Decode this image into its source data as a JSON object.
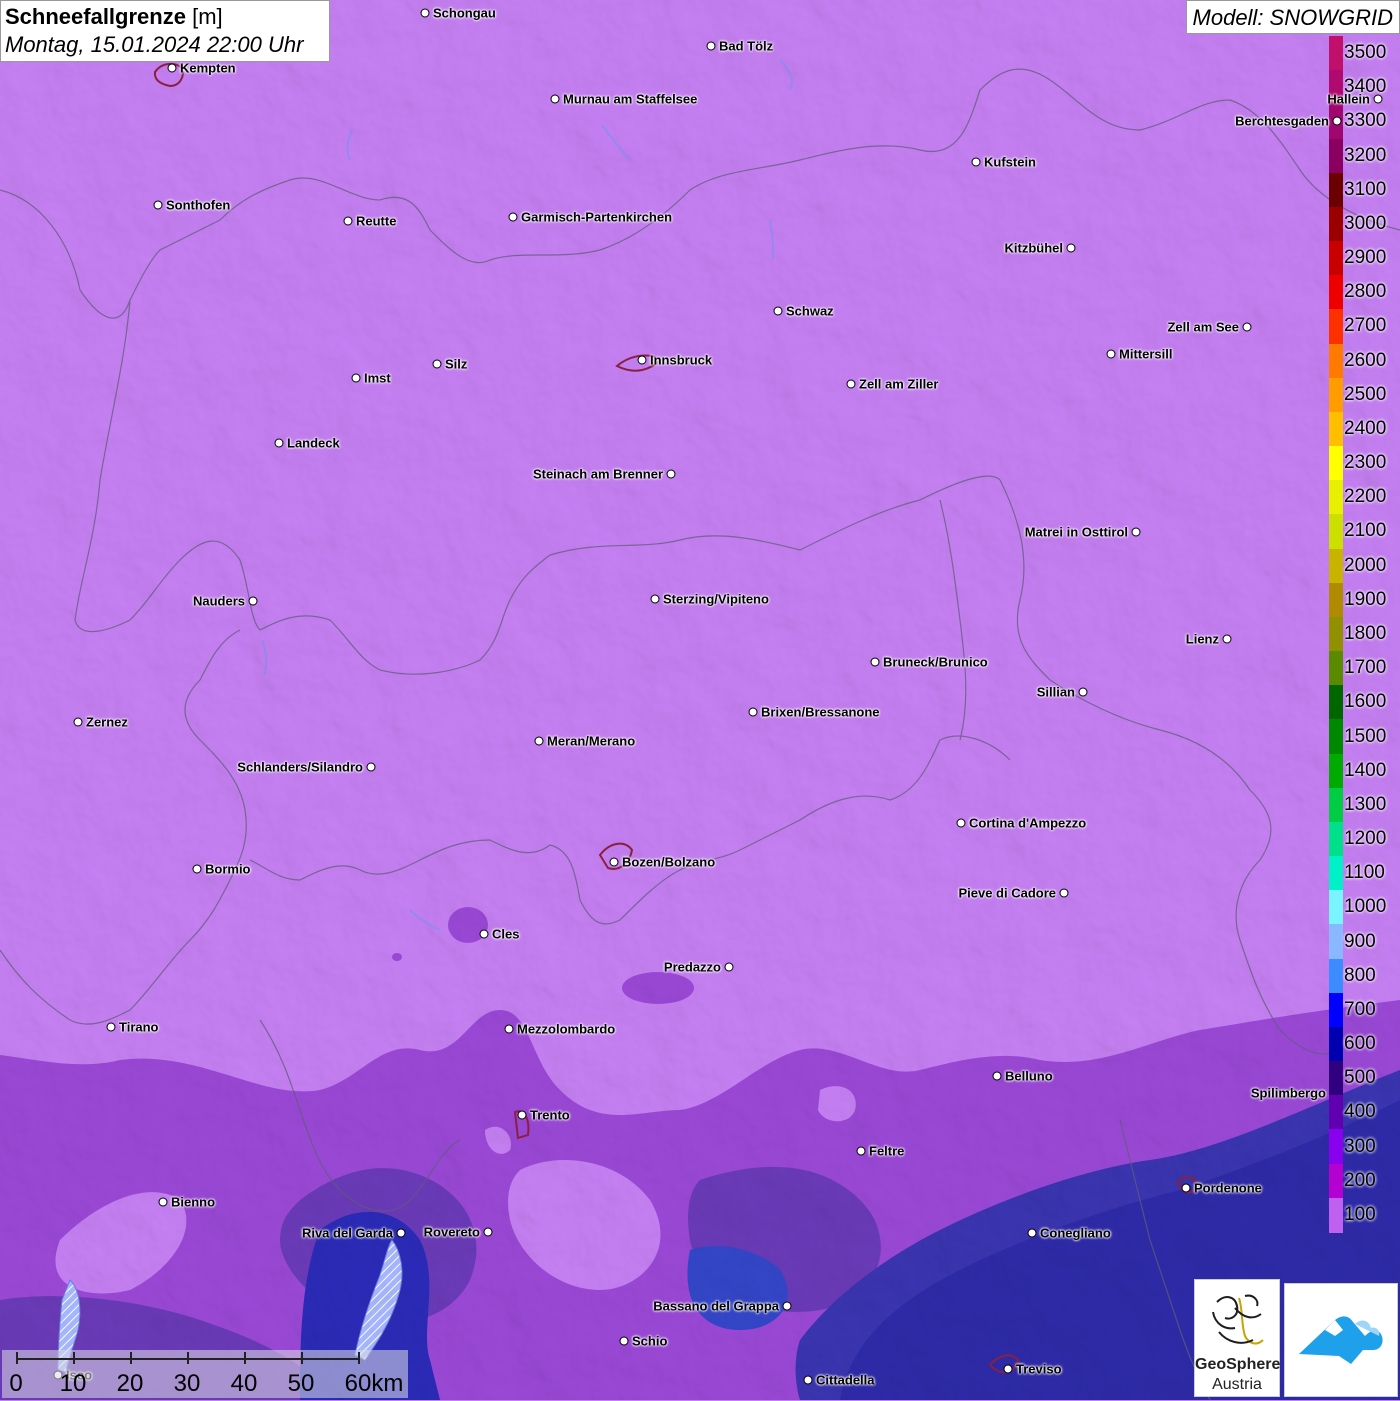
{
  "header": {
    "title": "Schneefallgrenze",
    "unit": "[m]",
    "datetime": "Montag, 15.01.2024 22:00 Uhr",
    "model": "Modell: SNOWGRID"
  },
  "colors": {
    "background_zone": "#c57ff2",
    "low_zone": "#3b2aa6",
    "mid_zone": "#8a3fc8"
  },
  "legend": {
    "items": [
      {
        "label": "3500",
        "color": "#c0106c"
      },
      {
        "label": "3400",
        "color": "#b00a70"
      },
      {
        "label": "3300",
        "color": "#a00670"
      },
      {
        "label": "3200",
        "color": "#8a0060"
      },
      {
        "label": "3100",
        "color": "#6a0000"
      },
      {
        "label": "3000",
        "color": "#9a0000"
      },
      {
        "label": "2900",
        "color": "#c80000"
      },
      {
        "label": "2800",
        "color": "#ee0000"
      },
      {
        "label": "2700",
        "color": "#ff3000"
      },
      {
        "label": "2600",
        "color": "#ff7a00"
      },
      {
        "label": "2500",
        "color": "#ff9c00"
      },
      {
        "label": "2400",
        "color": "#ffbe00"
      },
      {
        "label": "2300",
        "color": "#ffff00"
      },
      {
        "label": "2200",
        "color": "#e6f000"
      },
      {
        "label": "2100",
        "color": "#cce000"
      },
      {
        "label": "2000",
        "color": "#c8b400"
      },
      {
        "label": "1900",
        "color": "#b08a00"
      },
      {
        "label": "1800",
        "color": "#909000"
      },
      {
        "label": "1700",
        "color": "#5a8a00"
      },
      {
        "label": "1600",
        "color": "#006600"
      },
      {
        "label": "1500",
        "color": "#008800"
      },
      {
        "label": "1400",
        "color": "#00aa00"
      },
      {
        "label": "1300",
        "color": "#00cc44"
      },
      {
        "label": "1200",
        "color": "#00e08a"
      },
      {
        "label": "1100",
        "color": "#00f0c8"
      },
      {
        "label": "1000",
        "color": "#7af5ff"
      },
      {
        "label": "900",
        "color": "#8ab8ff"
      },
      {
        "label": "800",
        "color": "#3c8cff"
      },
      {
        "label": "700",
        "color": "#0000ff"
      },
      {
        "label": "600",
        "color": "#0000b0"
      },
      {
        "label": "500",
        "color": "#300080"
      },
      {
        "label": "400",
        "color": "#6000b0"
      },
      {
        "label": "300",
        "color": "#8800ee"
      },
      {
        "label": "200",
        "color": "#b400d0"
      },
      {
        "label": "100",
        "color": "#c060f0"
      }
    ]
  },
  "cities": [
    {
      "name": "Schongau",
      "side": "r"
    },
    {
      "name": "Bad Tölz",
      "side": "r"
    },
    {
      "name": "Kempten",
      "side": "r"
    },
    {
      "name": "Murnau am Staffelsee",
      "side": "r"
    },
    {
      "name": "Hallein",
      "side": "l"
    },
    {
      "name": "Berchtesgaden",
      "side": "l"
    },
    {
      "name": "Kufstein",
      "side": "r"
    },
    {
      "name": "Sonthofen",
      "side": "r"
    },
    {
      "name": "Reutte",
      "side": "r"
    },
    {
      "name": "Garmisch-Partenkirchen",
      "side": "r"
    },
    {
      "name": "Kitzbühel",
      "side": "l"
    },
    {
      "name": "Schwaz",
      "side": "r"
    },
    {
      "name": "Zell am See",
      "side": "l"
    },
    {
      "name": "Mittersill",
      "side": "r"
    },
    {
      "name": "Innsbruck",
      "side": "r"
    },
    {
      "name": "Imst",
      "side": "r"
    },
    {
      "name": "Silz",
      "side": "r"
    },
    {
      "name": "Zell am Ziller",
      "side": "r"
    },
    {
      "name": "Landeck",
      "side": "r"
    },
    {
      "name": "Steinach am Brenner",
      "side": "l"
    },
    {
      "name": "Matrei in Osttirol",
      "side": "l"
    },
    {
      "name": "Nauders",
      "side": "l"
    },
    {
      "name": "Sterzing/Vipiteno",
      "side": "r"
    },
    {
      "name": "Lienz",
      "side": "l"
    },
    {
      "name": "Bruneck/Brunico",
      "side": "r"
    },
    {
      "name": "Sillian",
      "side": "l"
    },
    {
      "name": "Zernez",
      "side": "r"
    },
    {
      "name": "Brixen/Bressanone",
      "side": "r"
    },
    {
      "name": "Meran/Merano",
      "side": "r"
    },
    {
      "name": "Schlanders/Silandro",
      "side": "l"
    },
    {
      "name": "Cortina d'Ampezzo",
      "side": "r"
    },
    {
      "name": "Bozen/Bolzano",
      "side": "r"
    },
    {
      "name": "Bormio",
      "side": "r"
    },
    {
      "name": "Pieve di Cadore",
      "side": "l"
    },
    {
      "name": "Cles",
      "side": "r"
    },
    {
      "name": "Predazzo",
      "side": "l"
    },
    {
      "name": "Tirano",
      "side": "r"
    },
    {
      "name": "Mezzolombardo",
      "side": "r"
    },
    {
      "name": "Belluno",
      "side": "r"
    },
    {
      "name": "Spilimbergo",
      "side": "r"
    },
    {
      "name": "Trento",
      "side": "r"
    },
    {
      "name": "Feltre",
      "side": "r"
    },
    {
      "name": "Pordenone",
      "side": "r"
    },
    {
      "name": "Bienno",
      "side": "r"
    },
    {
      "name": "Riva del Garda",
      "side": "l"
    },
    {
      "name": "Rovereto",
      "side": "l"
    },
    {
      "name": "Conegliano",
      "side": "r"
    },
    {
      "name": "Bassano del Grappa",
      "side": "l"
    },
    {
      "name": "Schio",
      "side": "r"
    },
    {
      "name": "Iseo",
      "side": "r"
    },
    {
      "name": "Treviso",
      "side": "r"
    },
    {
      "name": "Cittadella",
      "side": "r"
    }
  ],
  "scale": {
    "labels": [
      "0",
      "10",
      "20",
      "30",
      "40",
      "50",
      "60km"
    ]
  },
  "logos": {
    "geosphere_name": "GeoSphere",
    "geosphere_sub": "Austria"
  }
}
